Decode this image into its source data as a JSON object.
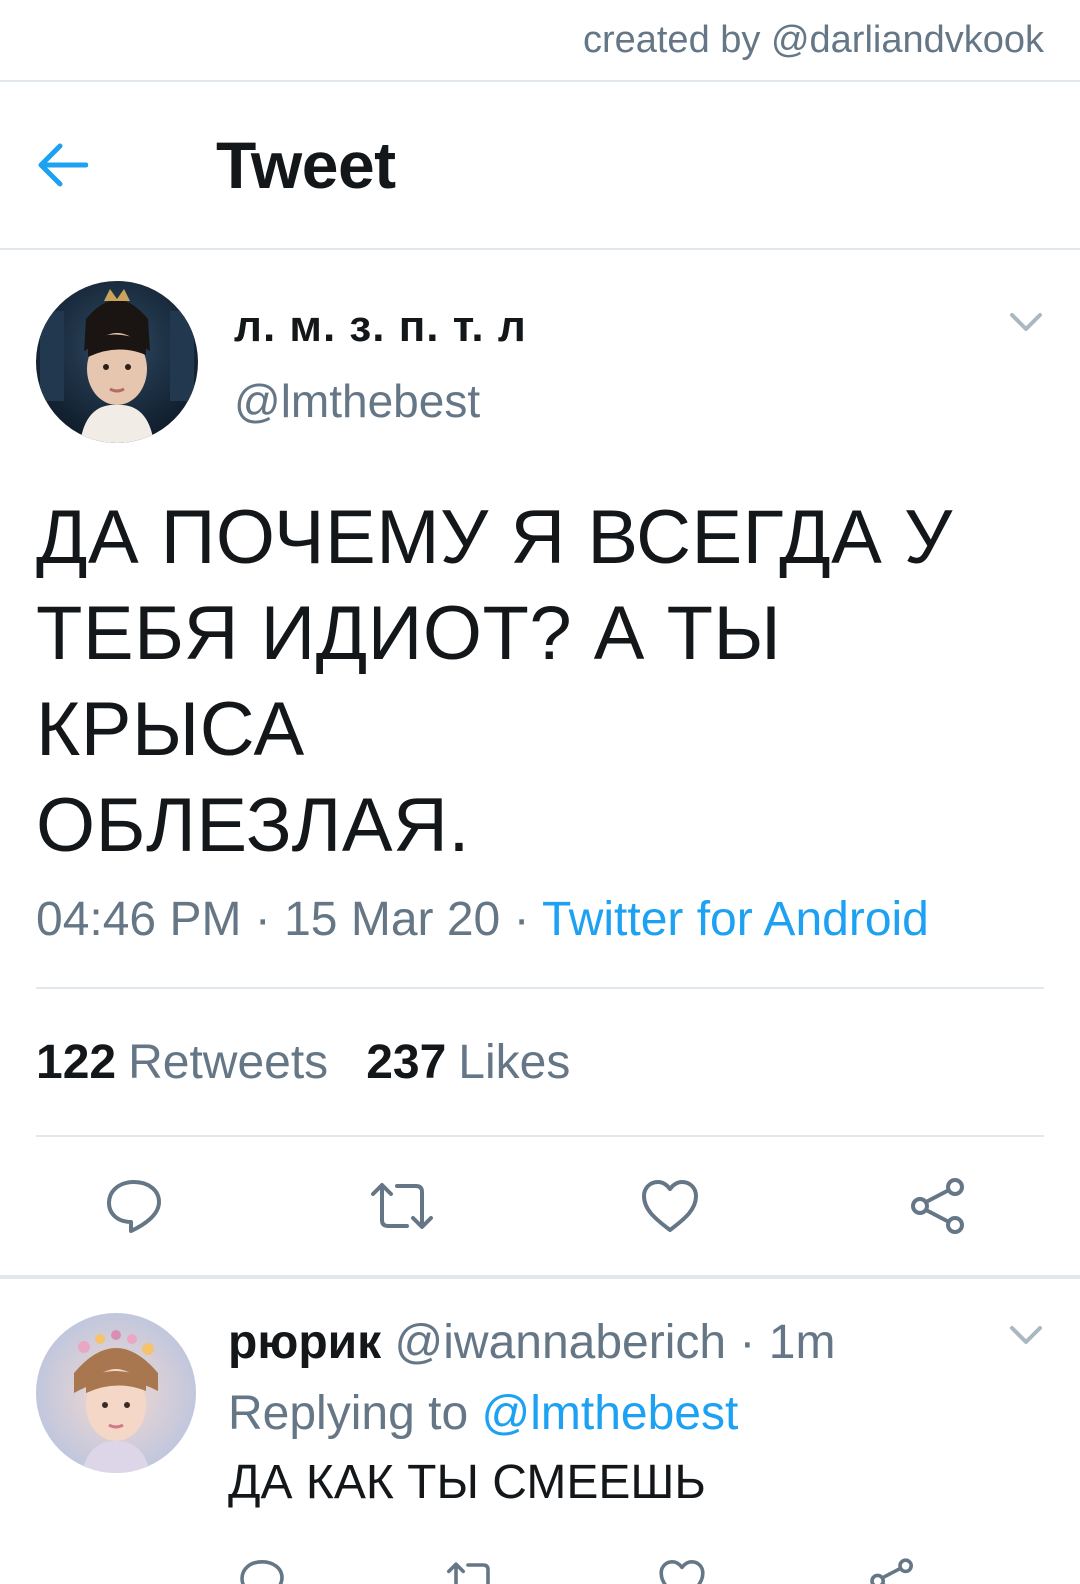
{
  "credit": "created by @darliandvkook",
  "header": {
    "title": "Tweet",
    "back_icon": "arrow-left-icon",
    "accent": "#1da1f2"
  },
  "tweet": {
    "display_name": "л. м. з. п. т. л",
    "handle": "@lmthebest",
    "text_lines": [
      "ДА ПОЧЕМУ Я ВСЕГДА У",
      "ТЕБЯ ИДИОТ? А ТЫ КРЫСА",
      "ОБЛЕЗЛАЯ."
    ],
    "time": "04:46 PM",
    "date": "15 Mar 20",
    "separator": " · ",
    "source": "Twitter for Android",
    "retweets_count": "122",
    "retweets_label": "Retweets",
    "likes_count": "237",
    "likes_label": "Likes",
    "actions": [
      "reply-icon",
      "retweet-icon",
      "like-icon",
      "share-icon"
    ]
  },
  "reply": {
    "display_name": "рюрик",
    "handle": "@iwannaberich",
    "age": " · 1m",
    "replying_prefix": "Replying to ",
    "replying_to": "@lmthebest",
    "text": "ДА КАК ТЫ СМЕЕШЬ",
    "actions": [
      "reply-icon",
      "retweet-icon",
      "like-icon",
      "share-icon"
    ]
  },
  "colors": {
    "text": "#14171a",
    "secondary": "#657786",
    "link": "#1da1f2",
    "divider": "#e1e8ed"
  }
}
